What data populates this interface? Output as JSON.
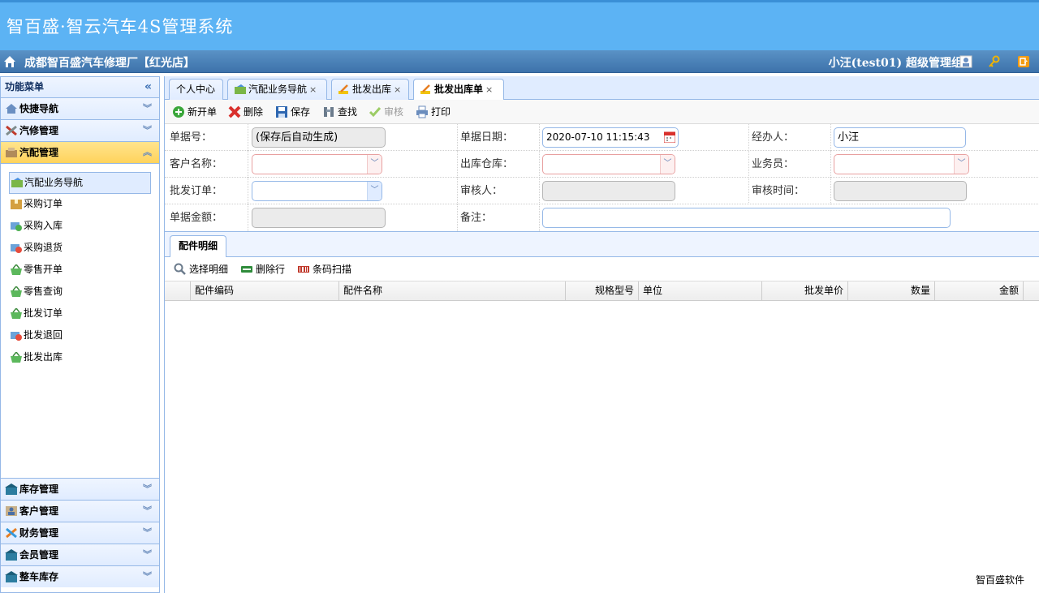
{
  "app": {
    "title": "智百盛·智云汽车4S管理系统",
    "shop_name": "成都智百盛汽车修理厂【红光店】",
    "user": "小汪(test01) 超级管理组"
  },
  "sidebar": {
    "title": "功能菜单",
    "collapse": "«",
    "sections_top": [
      {
        "label": "快捷导航",
        "icon": "home-nav-icon"
      },
      {
        "label": "汽修管理",
        "icon": "tools-icon"
      },
      {
        "label": "汽配管理",
        "icon": "parts-icon",
        "active": true
      }
    ],
    "items": [
      {
        "label": "汽配业务导航",
        "icon": "nav-map-icon",
        "selected": true
      },
      {
        "label": "采购订单",
        "icon": "order-box-icon"
      },
      {
        "label": "采购入库",
        "icon": "stock-in-icon"
      },
      {
        "label": "采购退货",
        "icon": "return-icon"
      },
      {
        "label": "零售开单",
        "icon": "basket-icon"
      },
      {
        "label": "零售查询",
        "icon": "basket-icon"
      },
      {
        "label": "批发订单",
        "icon": "basket-icon"
      },
      {
        "label": "批发退回",
        "icon": "return-icon"
      },
      {
        "label": "批发出库",
        "icon": "basket-icon"
      }
    ],
    "sections_bottom": [
      {
        "label": "库存管理",
        "icon": "warehouse-icon"
      },
      {
        "label": "客户管理",
        "icon": "customer-icon"
      },
      {
        "label": "财务管理",
        "icon": "finance-icon"
      },
      {
        "label": "会员管理",
        "icon": "member-icon"
      },
      {
        "label": "整车库存",
        "icon": "car-stock-icon"
      }
    ]
  },
  "tabs": [
    {
      "label": "个人中心",
      "closable": false
    },
    {
      "label": "汽配业务导航",
      "closable": true
    },
    {
      "label": "批发出库",
      "closable": true
    },
    {
      "label": "批发出库单",
      "closable": true,
      "active": true
    }
  ],
  "toolbar": {
    "new": "新开单",
    "delete": "删除",
    "save": "保存",
    "find": "查找",
    "audit": "审核",
    "print": "打印"
  },
  "form": {
    "bill_no_label": "单据号：",
    "bill_no_value": "(保存后自动生成)",
    "bill_date_label": "单据日期：",
    "bill_date_value": "2020-07-10 11:15:43",
    "handler_label": "经办人：",
    "handler_value": "小汪",
    "customer_label": "客户名称：",
    "warehouse_label": "出库仓库：",
    "salesman_label": "业务员：",
    "wholesale_order_label": "批发订单：",
    "auditor_label": "审核人：",
    "audit_time_label": "审核时间：",
    "amount_label": "单据金额：",
    "remark_label": "备注："
  },
  "detail": {
    "tab": "配件明细",
    "select_detail": "选择明细",
    "delete_row": "删除行",
    "barcode_scan": "条码扫描",
    "columns": [
      "配件编码",
      "配件名称",
      "规格型号",
      "单位",
      "批发单价",
      "数量",
      "金额"
    ]
  },
  "footer": "智百盛软件",
  "colors": {
    "header": "#5cb3f4",
    "subbar": "#3d72ab",
    "border": "#95b8e7",
    "active_section": "#ffd35c"
  }
}
